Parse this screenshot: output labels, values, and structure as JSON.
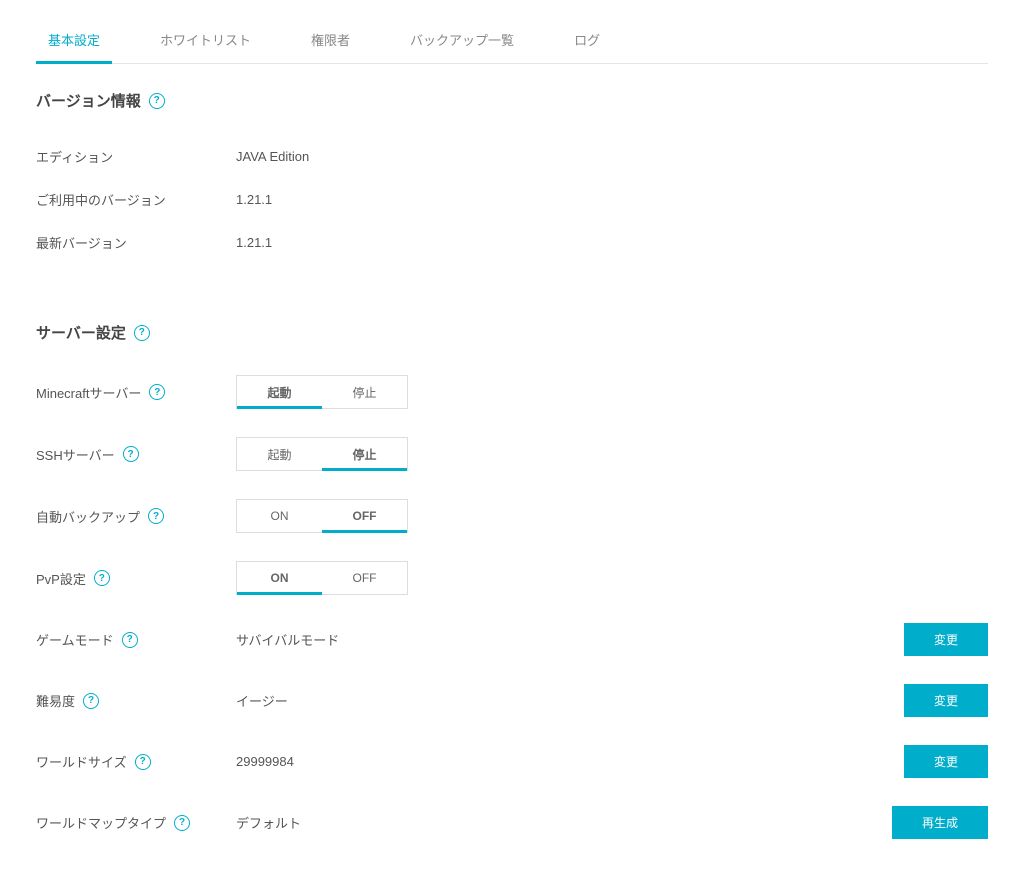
{
  "tabs": [
    {
      "label": "基本設定",
      "active": true
    },
    {
      "label": "ホワイトリスト",
      "active": false
    },
    {
      "label": "権限者",
      "active": false
    },
    {
      "label": "バックアップ一覧",
      "active": false
    },
    {
      "label": "ログ",
      "active": false
    }
  ],
  "version_section": {
    "title": "バージョン情報",
    "rows": {
      "edition": {
        "label": "エディション",
        "value": "JAVA Edition"
      },
      "current": {
        "label": "ご利用中のバージョン",
        "value": "1.21.1"
      },
      "latest": {
        "label": "最新バージョン",
        "value": "1.21.1"
      }
    }
  },
  "server_section": {
    "title": "サーバー設定",
    "minecraft": {
      "label": "Minecraftサーバー",
      "options": [
        "起動",
        "停止"
      ],
      "active_index": 0
    },
    "ssh": {
      "label": "SSHサーバー",
      "options": [
        "起動",
        "停止"
      ],
      "active_index": 1
    },
    "autobackup": {
      "label": "自動バックアップ",
      "options": [
        "ON",
        "OFF"
      ],
      "active_index": 1
    },
    "pvp": {
      "label": "PvP設定",
      "options": [
        "ON",
        "OFF"
      ],
      "active_index": 0
    },
    "gamemode": {
      "label": "ゲームモード",
      "value": "サバイバルモード",
      "button": "変更"
    },
    "difficulty": {
      "label": "難易度",
      "value": "イージー",
      "button": "変更"
    },
    "worldsize": {
      "label": "ワールドサイズ",
      "value": "29999984",
      "button": "変更"
    },
    "maptype": {
      "label": "ワールドマップタイプ",
      "value": "デフォルト",
      "button": "再生成"
    }
  },
  "help_glyph": "?"
}
